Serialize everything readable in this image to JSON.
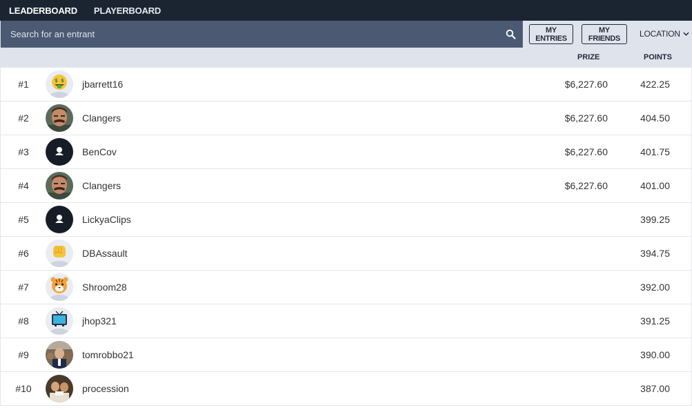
{
  "nav": {
    "tabs": [
      {
        "label": "LEADERBOARD",
        "active": true
      },
      {
        "label": "PLAYERBOARD",
        "active": false
      }
    ]
  },
  "search": {
    "placeholder": "Search for an entrant",
    "value": "",
    "icon": "search-icon"
  },
  "filters": {
    "my_entries_label": "MY ENTRIES",
    "my_friends_label": "MY FRIENDS",
    "location_label": "LOCATION"
  },
  "columns": {
    "prize": "PRIZE",
    "points": "POINTS"
  },
  "colors": {
    "nav_bg": "#1b2532",
    "search_bg": "#4b5a72",
    "header_bg": "#dfe3ec",
    "dark_avatar": "#161d27"
  },
  "entries": [
    {
      "rank": "#1",
      "name": "jbarrett16",
      "prize": "$6,227.60",
      "points": "422.25",
      "avatar": "money-mouth-emoji"
    },
    {
      "rank": "#2",
      "name": "Clangers",
      "prize": "$6,227.60",
      "points": "404.50",
      "avatar": "photo-mustache-man"
    },
    {
      "rank": "#3",
      "name": "BenCov",
      "prize": "$6,227.60",
      "points": "401.75",
      "avatar": "default-user"
    },
    {
      "rank": "#4",
      "name": "Clangers",
      "prize": "$6,227.60",
      "points": "401.00",
      "avatar": "photo-mustache-man"
    },
    {
      "rank": "#5",
      "name": "LickyaClips",
      "prize": "",
      "points": "399.25",
      "avatar": "default-user"
    },
    {
      "rank": "#6",
      "name": "DBAssault",
      "prize": "",
      "points": "394.75",
      "avatar": "fist-emoji"
    },
    {
      "rank": "#7",
      "name": "Shroom28",
      "prize": "",
      "points": "392.00",
      "avatar": "tiger-emoji"
    },
    {
      "rank": "#8",
      "name": "jhop321",
      "prize": "",
      "points": "391.25",
      "avatar": "tv-emoji"
    },
    {
      "rank": "#9",
      "name": "tomrobbo21",
      "prize": "",
      "points": "390.00",
      "avatar": "photo-crowd"
    },
    {
      "rank": "#10",
      "name": "procession",
      "prize": "",
      "points": "387.00",
      "avatar": "photo-group"
    }
  ]
}
